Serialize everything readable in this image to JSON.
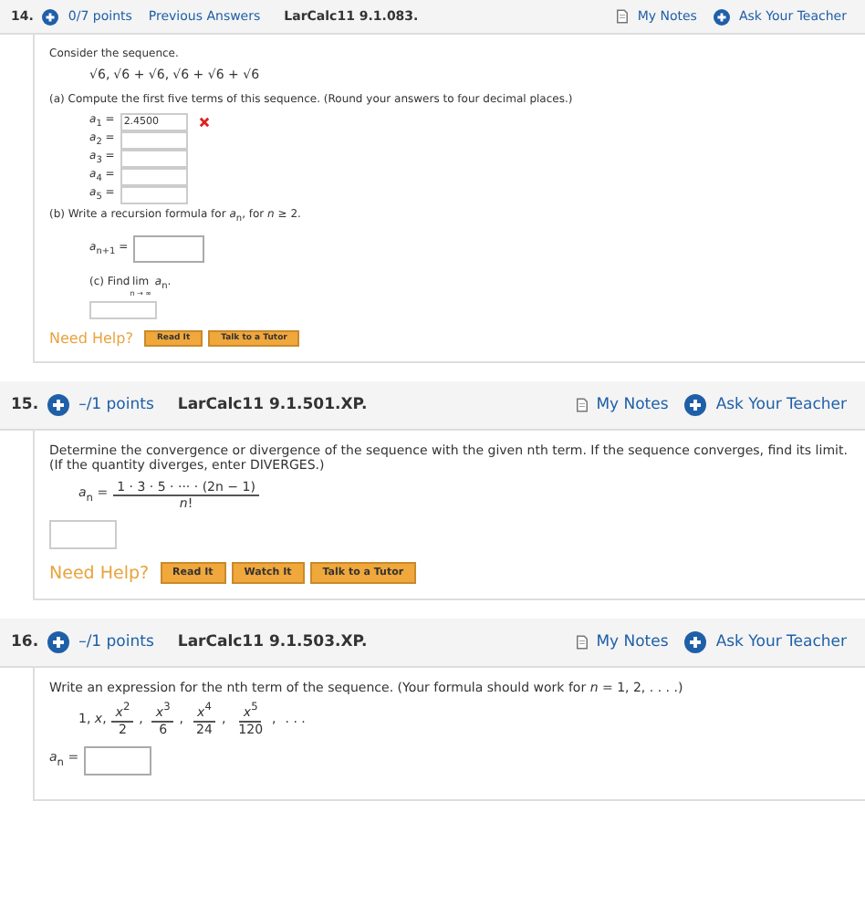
{
  "questions": [
    {
      "number": "14.",
      "points": "0/7 points",
      "previous_answers": "Previous Answers",
      "code": "LarCalc11 9.1.083.",
      "my_notes": "My Notes",
      "ask_teacher": "Ask Your Teacher",
      "parts": [
        {
          "kind": "text",
          "text": "Consider the sequence."
        },
        {
          "kind": "sqrt_sequence",
          "symbol": "√",
          "separator": ",",
          "terms": [
            {
              "radicand": "6"
            },
            {
              "radicand": "6 + ",
              "inner": {
                "radicand": "6"
              }
            },
            {
              "radicand": "6 + ",
              "inner": {
                "radicand": "6 + ",
                "inner": {
                  "radicand": "6"
                }
              }
            }
          ]
        },
        {
          "kind": "text",
          "text": "(a) Compute the first five terms of this sequence. (Round your answers to four decimal places.)"
        },
        {
          "kind": "answers",
          "rows": [
            {
              "label": "*a*$_{1}$ =",
              "value": "2.4500",
              "incorrect": true
            },
            {
              "label": "*a*$_{2}$ =",
              "incorrect": false
            },
            {
              "label": "*a*$_{3}$ =",
              "incorrect": false
            },
            {
              "label": "*a*$_{4}$ =",
              "incorrect": false
            },
            {
              "label": "*a*$_{5}$ =",
              "incorrect": false
            }
          ]
        },
        {
          "kind": "text",
          "text": "(b) Write a recursion formula for *a*$_{n}$, for *n* ≥ 2."
        },
        {
          "kind": "answers",
          "rows": [
            {
              "label": "*a*$_{n+1}$ =",
              "incorrect": false
            }
          ]
        },
        {
          "kind": "limit",
          "prefix": "(c) Find",
          "operator": "lim",
          "under": "n → ∞",
          "suffix": "*a*$_{n}$."
        },
        {
          "kind": "answers",
          "rows": [
            {
              "incorrect": false
            }
          ]
        }
      ],
      "need_help": "Need Help?",
      "help_buttons": [
        "Read It",
        "Talk to a Tutor"
      ]
    },
    {
      "number": "15.",
      "points": "–/1 points",
      "code": "LarCalc11 9.1.501.XP.",
      "my_notes": "My Notes",
      "ask_teacher": "Ask Your Teacher",
      "parts": [
        {
          "kind": "text",
          "text": "Determine the convergence or divergence of the sequence with the given nth term. If the sequence converges, find its limit. (If the quantity diverges, enter DIVERGES.)"
        },
        {
          "kind": "fraction",
          "lhs": "*a*$_{n}$ =",
          "numerator": "1 · 3 · 5 · ··· · (2n − 1)",
          "denominator": "*n*!"
        },
        {
          "kind": "answers",
          "rows": [
            {
              "incorrect": false
            }
          ]
        }
      ],
      "need_help": "Need Help?",
      "help_buttons": [
        "Read It",
        "Watch It",
        "Talk to a Tutor"
      ]
    },
    {
      "number": "16.",
      "points": "–/1 points",
      "code": "LarCalc11 9.1.503.XP.",
      "my_notes": "My Notes",
      "ask_teacher": "Ask Your Teacher",
      "parts": [
        {
          "kind": "text",
          "text": "Write an expression for the nth term of the sequence. (Your formula should work for *n* = 1, 2, . . . .)"
        },
        {
          "kind": "series",
          "lead": "1, *x*,",
          "separator": ",",
          "fractions": [
            {
              "num": "*x*$^{2}$",
              "den": "2"
            },
            {
              "num": "*x*$^{3}$",
              "den": "6"
            },
            {
              "num": "*x*$^{4}$",
              "den": "24"
            },
            {
              "num": "*x*$^{5}$",
              "den": "120"
            }
          ],
          "tail": ". . ."
        },
        {
          "kind": "answers",
          "rows": [
            {
              "label": "*a*$_{n}$ =",
              "incorrect": false
            }
          ]
        }
      ]
    }
  ]
}
